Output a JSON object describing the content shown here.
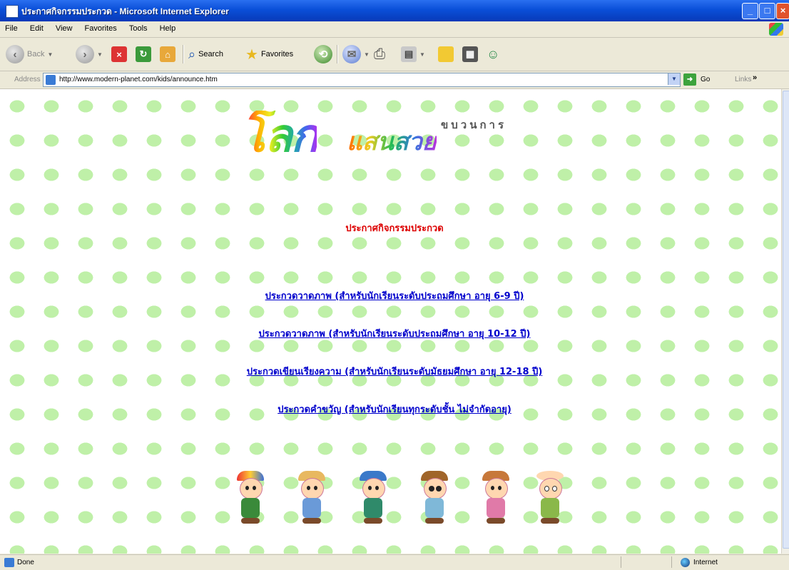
{
  "window": {
    "title": "ประกาศกิจกรรมประกวด - Microsoft Internet Explorer"
  },
  "menu": [
    "File",
    "Edit",
    "View",
    "Favorites",
    "Tools",
    "Help"
  ],
  "toolbar": {
    "back_label": "Back",
    "search_label": "Search",
    "favorites_label": "Favorites"
  },
  "address": {
    "label": "Address",
    "url": "http://www.modern-planet.com/kids/announce.htm",
    "go_label": "Go",
    "links_label": "Links"
  },
  "logo": {
    "top_text": "ขบวนการ",
    "big_text": "โลก",
    "small_text": "แสนสวย"
  },
  "page": {
    "heading": "ประกาศกิจกรรมประกวด",
    "links": [
      "ประกวดวาดภาพ (สำหรับนักเรียนระดับประถมศึกษา อายุ 6-9 ปี)",
      "ประกวดวาดภาพ (สำหรับนักเรียนระดับประถมศึกษา อายุ 10-12 ปี)",
      "ประกวดเขียนเรียงความ (สำหรับนักเรียนระดับมัธยมศึกษา อายุ 12-18 ปี)",
      "ประกวดคำขวัญ (สำหรับนักเรียนทุกระดับชั้น ไม่จำกัดอายุ)"
    ]
  },
  "status": {
    "text": "Done",
    "zone": "Internet"
  },
  "colors": {
    "heading": "#dd0000",
    "link": "#0000cc",
    "pattern": "#bff0a8"
  }
}
